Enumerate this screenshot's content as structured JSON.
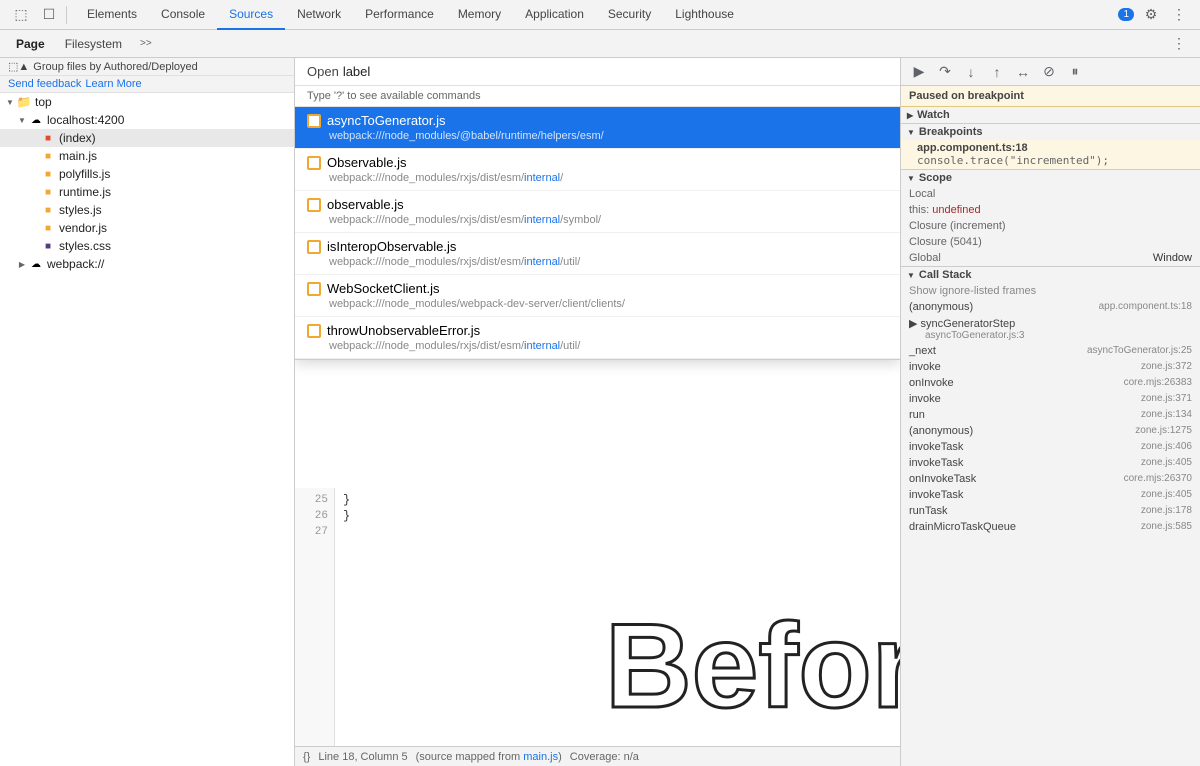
{
  "toolbar": {
    "tabs": [
      "Elements",
      "Console",
      "Sources",
      "Network",
      "Performance",
      "Memory",
      "Application",
      "Security",
      "Lighthouse"
    ],
    "active_tab": "Sources",
    "icons": {
      "inspect": "⬚",
      "device": "☐",
      "settings": "⚙",
      "more": "⋮",
      "chat_badge": "1"
    }
  },
  "sources_subtabs": {
    "tabs": [
      "Page",
      "Filesystem"
    ],
    "active": "Page",
    "more": ">>"
  },
  "file_panel": {
    "group_label": "Group files by Authored/Deployed",
    "feedback_link": "Send feedback",
    "learn_link": "Learn More",
    "tree": [
      {
        "id": "top",
        "label": "top",
        "type": "root",
        "indent": 0,
        "expanded": true
      },
      {
        "id": "localhost",
        "label": "localhost:4200",
        "type": "server",
        "indent": 1,
        "expanded": true
      },
      {
        "id": "index",
        "label": "(index)",
        "type": "html",
        "indent": 2,
        "selected": true
      },
      {
        "id": "main",
        "label": "main.js",
        "type": "js",
        "indent": 2
      },
      {
        "id": "polyfills",
        "label": "polyfills.js",
        "type": "js",
        "indent": 2
      },
      {
        "id": "runtime",
        "label": "runtime.js",
        "type": "js",
        "indent": 2
      },
      {
        "id": "styles",
        "label": "styles.js",
        "type": "js",
        "indent": 2
      },
      {
        "id": "vendor",
        "label": "vendor.js",
        "type": "js",
        "indent": 2
      },
      {
        "id": "stylescss",
        "label": "styles.css",
        "type": "css",
        "indent": 2
      },
      {
        "id": "webpack",
        "label": "webpack://",
        "type": "server",
        "indent": 1
      }
    ]
  },
  "open_dialog": {
    "label": "Open",
    "input_value": "label",
    "hint": "Type '?' to see available commands",
    "results": [
      {
        "id": "async-to-gen",
        "name": "asyncToGenerator.js",
        "path": "webpack:///node_modules/@babel/runtime/helpers/esm/",
        "path_highlight_start": 40,
        "path_highlight_end": 44,
        "selected": true,
        "icon_color": "#f0a830"
      },
      {
        "id": "observable",
        "name": "Observable.js",
        "path": "webpack:///node_modules/rxjs/dist/esm/internal/",
        "path_highlight": "internal",
        "selected": false,
        "icon_color": "#f0a830"
      },
      {
        "id": "observable2",
        "name": "observable.js",
        "path": "webpack:///node_modules/rxjs/dist/esm/internal/symbol/",
        "path_highlight": "internal",
        "selected": false,
        "icon_color": "#f0a830"
      },
      {
        "id": "interop",
        "name": "isInteropObservable.js",
        "path": "webpack:///node_modules/rxjs/dist/esm/internal/util/",
        "path_highlight": "internal",
        "selected": false,
        "icon_color": "#f0a830"
      },
      {
        "id": "websocket",
        "name": "WebSocketClient.js",
        "path": "webpack:///node_modules/webpack-dev-server/client/clients/",
        "selected": false,
        "icon_color": "#f0a830"
      },
      {
        "id": "throw-unobs",
        "name": "throwUnobservableError.js",
        "path": "webpack:///node_modules/rxjs/dist/esm/internal/util/",
        "path_highlight": "internal",
        "selected": false,
        "icon_color": "#f0a830"
      }
    ]
  },
  "code_editor": {
    "lines": [
      "25    }",
      "26    }",
      "27"
    ],
    "status": {
      "format_btn": "{}",
      "position": "Line 18, Column 5",
      "source_map": "(source mapped from main.js)",
      "coverage": "Coverage: n/a"
    }
  },
  "before_text": "Before",
  "right_panel": {
    "paused_label": "aused on breakpoint",
    "debug_controls": [
      "↩",
      "↷",
      "↑",
      "↔",
      "⊘",
      "⏸"
    ],
    "sections": {
      "watch": {
        "label": "atch",
        "expanded": false
      },
      "breakpoints": {
        "label": "eakpoints",
        "expanded": true,
        "items": [
          {
            "file": "app.component.ts:18",
            "code": "console.trace(\"incremented\");"
          }
        ]
      },
      "scope": {
        "label": "cope",
        "expanded": true,
        "items": [
          {
            "label": "cal",
            "value": ""
          },
          {
            "label": "his:",
            "value": "undefined"
          },
          {
            "label": "osure (increment)",
            "value": ""
          },
          {
            "label": "osure (5041)",
            "value": ""
          },
          {
            "label": "obal",
            "value": "Window"
          }
        ]
      },
      "call_stack": {
        "label": "all Stack",
        "expanded": true,
        "show_ignore": "how ignore-listed frames",
        "items": [
          {
            "name": "(anonymous)",
            "loc": "app.component.ts:18"
          },
          {
            "name": "▶ syncGeneratorStep",
            "loc": "",
            "sub": "asyncToGenerator.js:3"
          },
          {
            "name": "_next",
            "loc": "asyncToGenerator.js:25"
          },
          {
            "name": "invoke",
            "loc": "zone.js:372"
          },
          {
            "name": "onInvoke",
            "loc": "core.mjs:26383"
          },
          {
            "name": "invoke",
            "loc": "zone.js:371"
          },
          {
            "name": "run",
            "loc": "zone.js:134"
          },
          {
            "name": "(anonymous)",
            "loc": "zone.js:1275"
          },
          {
            "name": "invokeTask",
            "loc": "zone.js:406"
          },
          {
            "name": "invokeTask",
            "loc": "zone.js:405"
          },
          {
            "name": "onInvokeTask",
            "loc": "core.mjs:26370"
          },
          {
            "name": "invokeTask",
            "loc": "zone.js:405"
          },
          {
            "name": "runTask",
            "loc": "zone.js:178"
          },
          {
            "name": "drainMicroTaskQueue",
            "loc": "zone.js:585"
          }
        ]
      }
    }
  }
}
